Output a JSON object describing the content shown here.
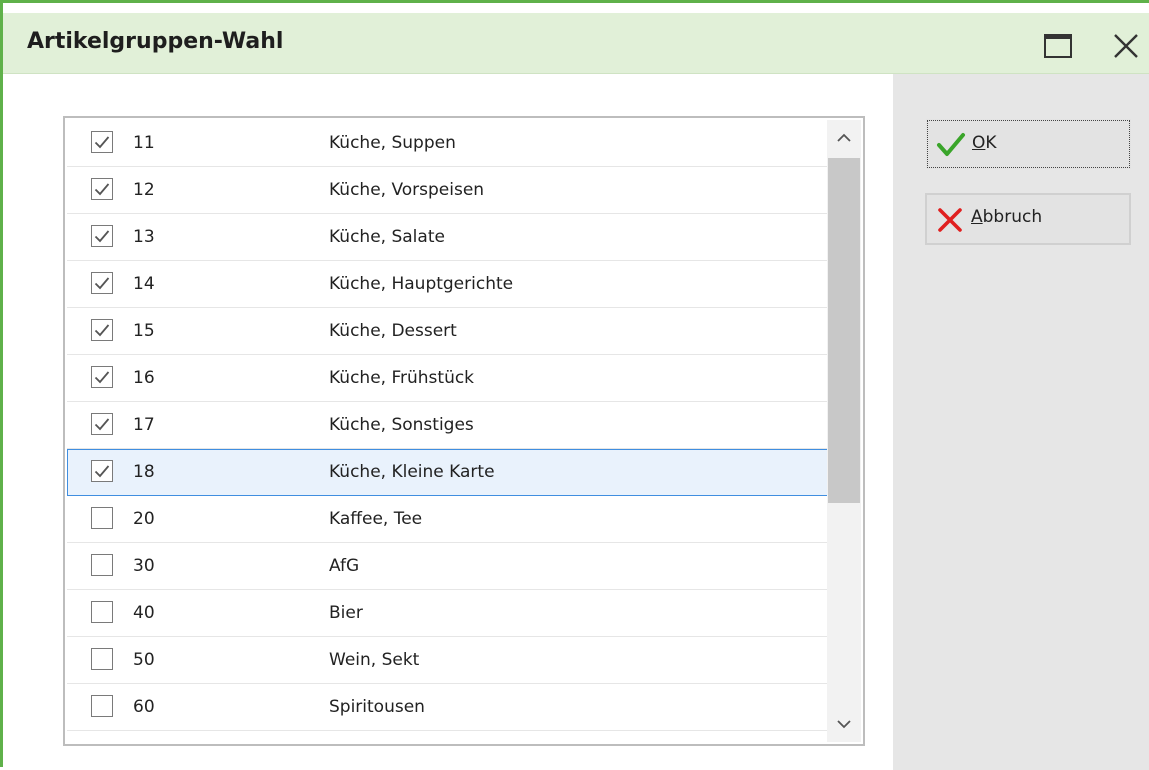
{
  "window": {
    "title": "Artikelgruppen-Wahl",
    "maximize_icon": "maximize-icon",
    "close_icon": "close-icon"
  },
  "list": {
    "rows": [
      {
        "code": "11",
        "name": "Küche, Suppen",
        "checked": true,
        "selected": false
      },
      {
        "code": "12",
        "name": "Küche, Vorspeisen",
        "checked": true,
        "selected": false
      },
      {
        "code": "13",
        "name": "Küche, Salate",
        "checked": true,
        "selected": false
      },
      {
        "code": "14",
        "name": "Küche, Hauptgerichte",
        "checked": true,
        "selected": false
      },
      {
        "code": "15",
        "name": "Küche, Dessert",
        "checked": true,
        "selected": false
      },
      {
        "code": "16",
        "name": "Küche, Frühstück",
        "checked": true,
        "selected": false
      },
      {
        "code": "17",
        "name": "Küche, Sonstiges",
        "checked": true,
        "selected": false
      },
      {
        "code": "18",
        "name": "Küche, Kleine Karte",
        "checked": true,
        "selected": true
      },
      {
        "code": "20",
        "name": "Kaffee, Tee",
        "checked": false,
        "selected": false
      },
      {
        "code": "30",
        "name": "AfG",
        "checked": false,
        "selected": false
      },
      {
        "code": "40",
        "name": "Bier",
        "checked": false,
        "selected": false
      },
      {
        "code": "50",
        "name": "Wein, Sekt",
        "checked": false,
        "selected": false
      },
      {
        "code": "60",
        "name": "Spiritousen",
        "checked": false,
        "selected": false
      }
    ]
  },
  "buttons": {
    "ok": {
      "mnemonic": "O",
      "rest": "K",
      "icon": "checkmark-icon",
      "color": "#3aa52a"
    },
    "cancel": {
      "mnemonic": "A",
      "rest": "bbruch",
      "icon": "x-icon",
      "color": "#e02020"
    }
  },
  "colors": {
    "accent": "#5fb14a",
    "titlebar_bg": "#e1f0d8",
    "selection_border": "#3f8ee0"
  }
}
